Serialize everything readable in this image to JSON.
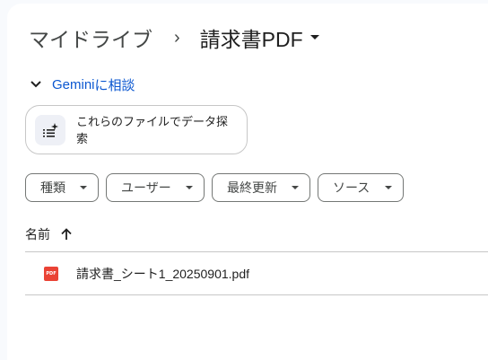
{
  "breadcrumb": {
    "root": "マイドライブ",
    "separator": "›",
    "current": "請求書PDF"
  },
  "gemini": {
    "brand": "Gemini",
    "action": " に相談"
  },
  "suggestion": {
    "icon": "sparkle-list-icon",
    "text": "これらのファイルでデータ探索"
  },
  "filters": [
    {
      "label": "種類"
    },
    {
      "label": "ユーザー"
    },
    {
      "label": "最終更新"
    },
    {
      "label": "ソース"
    }
  ],
  "table": {
    "column_name": "名前",
    "sort": "ascending",
    "rows": [
      {
        "icon": "pdf-icon",
        "icon_text": "PDF",
        "name": "請求書_シート1_20250901.pdf"
      }
    ]
  },
  "colors": {
    "accent": "#0b57d0",
    "pdf": "#ea4335",
    "background": "#f8fafd"
  }
}
